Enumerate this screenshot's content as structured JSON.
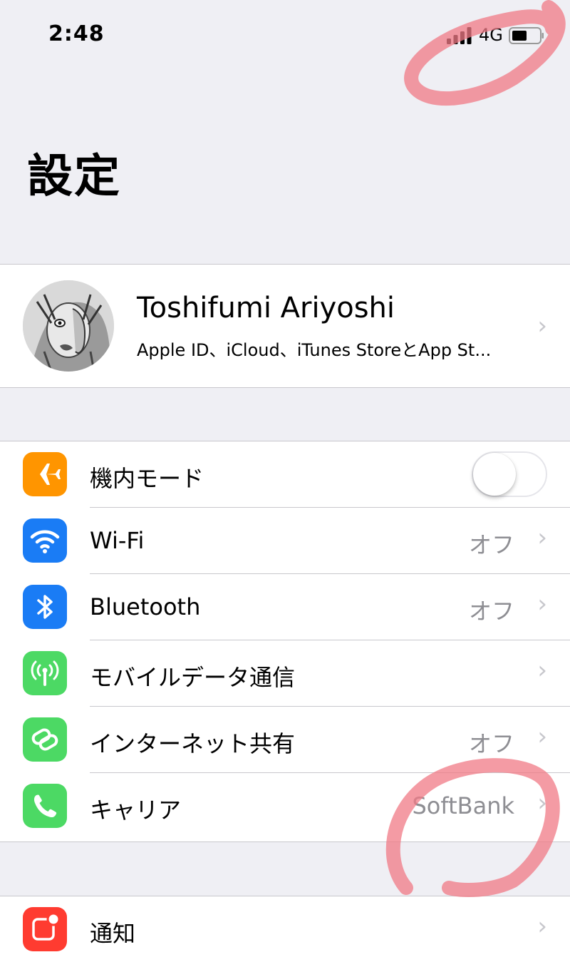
{
  "status_bar": {
    "time": "2:48",
    "network": "4G",
    "signal_icon": "signal-bars-icon",
    "battery_icon": "battery-icon",
    "battery_level": 0.5
  },
  "page_title": "設定",
  "profile": {
    "name": "Toshifumi Ariyoshi",
    "subtitle": "Apple ID、iCloud、iTunes StoreとApp St...",
    "avatar_icon": "avatar-image"
  },
  "settings": [
    {
      "label": "機内モード",
      "type": "toggle",
      "toggle_on": false,
      "icon": "airplane-icon",
      "color": "#ff9500"
    },
    {
      "label": "Wi-Fi",
      "value": "オフ",
      "icon": "wifi-icon",
      "color": "#1a7cf5"
    },
    {
      "label": "Bluetooth",
      "value": "オフ",
      "icon": "bluetooth-icon",
      "color": "#1a7cf5"
    },
    {
      "label": "モバイルデータ通信",
      "value": "",
      "icon": "antenna-icon",
      "color": "#4cd964"
    },
    {
      "label": "インターネット共有",
      "value": "オフ",
      "icon": "hotspot-link-icon",
      "color": "#4cd964"
    },
    {
      "label": "キャリア",
      "value": "SoftBank",
      "icon": "phone-icon",
      "color": "#4cd964"
    }
  ],
  "notifications": {
    "label": "通知",
    "icon": "notification-icon",
    "color": "#ff3b30"
  },
  "colors": {
    "background": "#efeff4",
    "separator": "#c8c7cc",
    "secondary_text": "#8e8e93",
    "annotation": "#f07a85"
  }
}
